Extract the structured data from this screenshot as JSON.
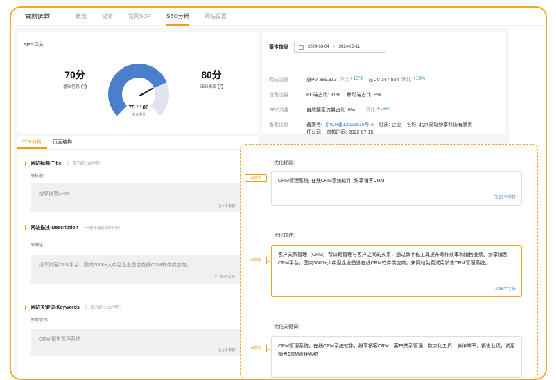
{
  "nav": {
    "brand": "官网运营",
    "items": [
      "概览",
      "线索",
      "官网SOP",
      "SEO分析",
      "网站设置"
    ],
    "active_index": 3
  },
  "score": {
    "title": "SEO评分",
    "basic_value": "70分",
    "basic_label": "基础信息",
    "perf_value": "80分",
    "perf_label": "SEO表现",
    "gauge_value": "75 / 100",
    "gauge_label": "综合得分",
    "gauge_fraction": 0.75,
    "gauge_color": "#4a7fc9",
    "gauge_track": "#dfe4ee"
  },
  "info": {
    "title": "基本信息",
    "date_start": "2024-03-04",
    "date_sep": "-",
    "date_end": "2024-03-11",
    "traffic_label": "网站流量",
    "pv": "总PV 389,813",
    "pv_ring_label": "环比",
    "pv_ring": "+13%",
    "uv": "总UV 347,564",
    "uv_ring_label": "环比",
    "uv_ring": "+13%",
    "device_label": "设备流量",
    "pc": "PC端占比:  91%",
    "mobile": "移动端占比:  9%",
    "seo_label": "SEO流量",
    "natural": "自然搜索流量占比:  8%",
    "seo_ring_label": "环比",
    "seo_ring": "+15%",
    "record_label": "备案信息",
    "record_no_label": "备案号:",
    "record_no": "京ICP备12021815号-2",
    "nature": "性质:  企业",
    "name_line1": "名称:  北京易动纷享科技有限责",
    "name_line2": "任公司",
    "audit_time": "审核时间:  2022-07-15"
  },
  "tdk": {
    "tabs": [
      "TDK分析",
      "页面结构"
    ],
    "title_section": "网站标题-Title",
    "title_hint": "（一般不超过80字符）",
    "orig_title_label": "原标题:",
    "orig_title": "纷享销客CRM",
    "orig_title_count": "7个字符",
    "desc_section": "网站描述-Description",
    "desc_hint": "（一般不超过200字符）",
    "orig_desc_label": "原描述:",
    "orig_desc": "纷享销客CRM平台，国内5000+大中型企业首选在线CRM软件供应商。",
    "orig_desc_count": "35个字符",
    "kw_section": "网站关键词-Keywords",
    "kw_hint": "（一般不超过100字符）",
    "orig_kw_label": "原关键词:",
    "orig_kw": "CRM 销售管理系统",
    "orig_kw_count": "9个字符"
  },
  "optimize": {
    "ai_label": "AI优化",
    "title_label": "优化标题:",
    "title_value": "CRM管理系统_在线CRM系统软件_纷享销客CRM",
    "title_count": "27个字符",
    "desc_label": "优化描述:",
    "desc_value": "客户关系管理（CRM）帮公司管理与客户之间的关系，通过数字化工具提升写作效率和销售业绩。纷享销客CRM平台，国内5000+大中型企业首选在线CRM软件供应商，来网站免费试用销售CRM管理系统。",
    "desc_count": "96个字符",
    "kw_label": "优化关键词:",
    "kw_value": "CRM管理系统，在线CRM系统软件，纷享销客CRM，客户关系管理，数字化工具，协作效率，销售业绩，试用销售CRM管理系统"
  }
}
